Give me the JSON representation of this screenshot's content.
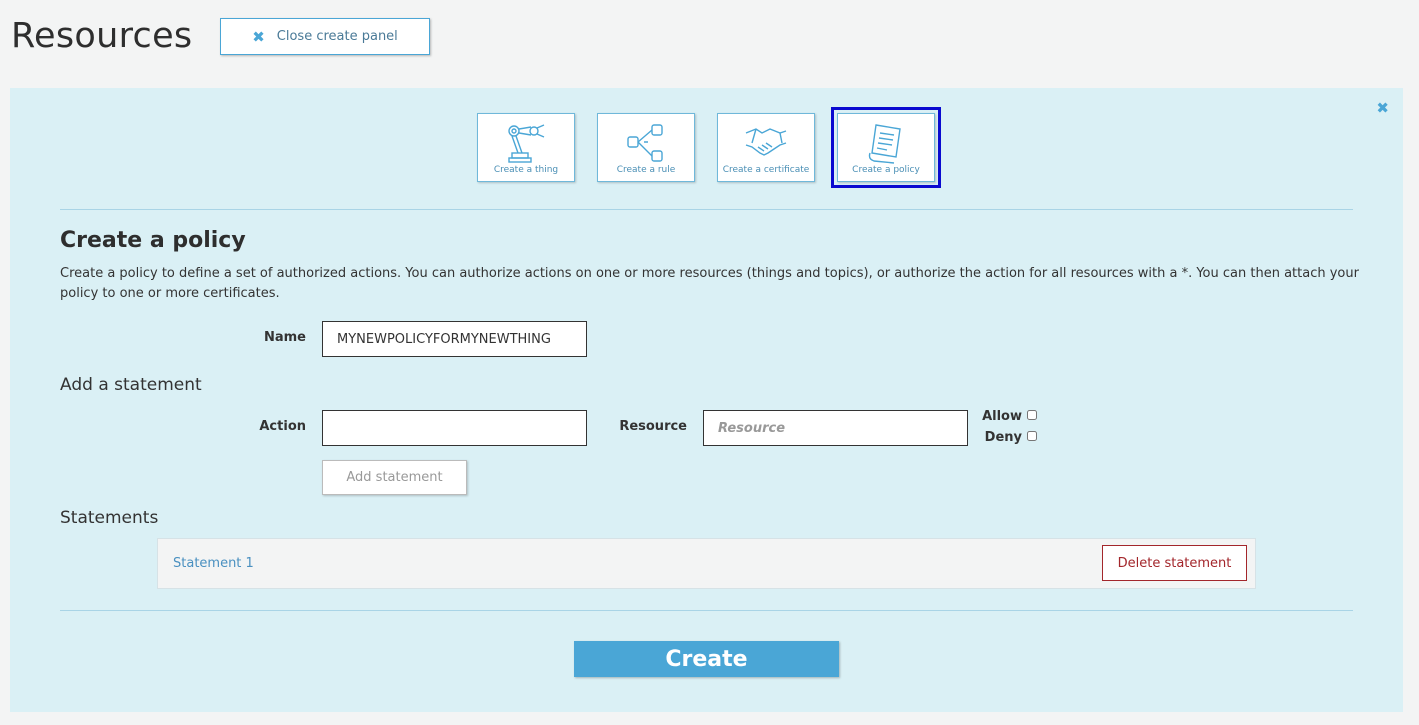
{
  "header": {
    "title": "Resources",
    "close_panel_label": "Close create panel",
    "close_icon": "close-icon"
  },
  "tiles": [
    {
      "label": "Create a thing",
      "icon": "robot-arm-icon"
    },
    {
      "label": "Create a rule",
      "icon": "flow-icon"
    },
    {
      "label": "Create a certificate",
      "icon": "handshake-icon"
    },
    {
      "label": "Create a policy",
      "icon": "document-icon",
      "selected": true
    }
  ],
  "form": {
    "title": "Create a policy",
    "description": "Create a policy to define a set of authorized actions. You can authorize actions on one or more resources (things and topics), or authorize the action for all resources with a *. You can then attach your policy to one or more certificates.",
    "name_label": "Name",
    "name_value": "MYNEWPOLICYFORMYNEWTHING",
    "add_statement_heading": "Add a statement",
    "action_label": "Action",
    "action_value": "",
    "resource_label": "Resource",
    "resource_placeholder": "Resource",
    "allow_label": "Allow",
    "deny_label": "Deny",
    "add_statement_button": "Add statement",
    "statements_heading": "Statements",
    "statements": [
      {
        "label": "Statement 1",
        "delete_label": "Delete statement"
      }
    ],
    "create_button": "Create"
  },
  "colors": {
    "accent": "#4aa6d6",
    "panel_bg": "#daf0f5",
    "danger": "#a3262b",
    "selection_outline": "#0a0ad0"
  }
}
